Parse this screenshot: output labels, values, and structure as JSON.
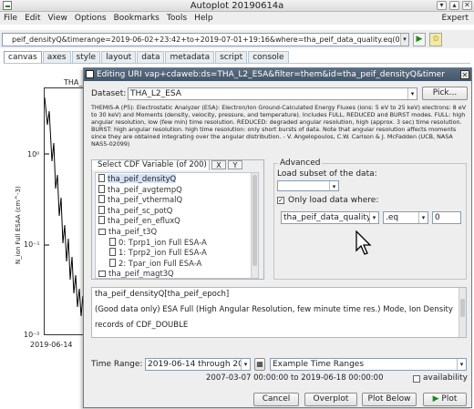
{
  "main_window": {
    "title": "Autoplot 20190614a",
    "controls": [
      "▾",
      "▴",
      "✕"
    ],
    "menu": [
      "File",
      "Edit",
      "View",
      "Options",
      "Bookmarks",
      "Tools",
      "Help"
    ],
    "expert_label": "Expert",
    "uri": "peif_densityQ&timerange=2019-06-02+23:42+to+2019-07-01+19:16&where=tha_peif_data_quality.eq(0)",
    "uri_dropdown": "▾",
    "go_button": "▶",
    "bookmark_button": "✩",
    "tabs": [
      "canvas",
      "axes",
      "style",
      "layout",
      "data",
      "metadata",
      "script",
      "console"
    ],
    "active_tab": "canvas"
  },
  "plot": {
    "title": "THA_L",
    "ylabel": "N_ion Full ESAA (cm^-3)",
    "yticks": [
      "10⁰",
      "10⁻¹",
      "10⁻²"
    ],
    "xtick": "2019-06-14"
  },
  "dialog": {
    "title": "Editing URI vap+cdaweb:ds=THA_L2_ESA&filter=them&id=tha_peif_densityQ&timer",
    "close": "✕",
    "dataset_label": "Dataset:",
    "dataset_value": "THA_L2_ESA",
    "pick_button": "Pick...",
    "description": "THEMIS-A (P5): Electrostatic Analyzer (ESA): Electron/Ion Ground-Calculated Energy Fluxes (ions: 5 eV to 25 keV) electrons: 8 eV to 30 keV) and Moments (density, velocity, pressure, and temperature). Includes FULL, REDUCED and BURST modes. FULL: high angular resolution, low (few min) time resolution. REDUCED: degraded angular resolution, high (approx. 3 sec) time resolution. BURST: high angular resolution. high time resolution: only short bursts of data. Note that angular resolution affects moments since they are obtained integrating over the angular distribution. - V. Angelopoulos, C.W. Carlson & J. McFadden (UCB, NASA NAS5-02099)",
    "cdf_tab_label": "Select CDF Variable (of 200)",
    "x_button": "X",
    "y_button": "Y",
    "variables": [
      {
        "label": "tha_peif_densityQ",
        "kind": "doc",
        "indent": 0,
        "selected": true
      },
      {
        "label": "tha_peif_avgtempQ",
        "kind": "doc",
        "indent": 0,
        "selected": false
      },
      {
        "label": "tha_peif_vthermalQ",
        "kind": "doc",
        "indent": 0,
        "selected": false
      },
      {
        "label": "tha_peif_sc_potQ",
        "kind": "doc",
        "indent": 0,
        "selected": false
      },
      {
        "label": "tha_peif_en_efluxQ",
        "kind": "doc",
        "indent": 0,
        "selected": false
      },
      {
        "label": "tha_peif_t3Q",
        "kind": "folder",
        "indent": 0,
        "selected": false
      },
      {
        "label": "0: Tprp1_ion Full ESA-A",
        "kind": "doc",
        "indent": 1,
        "selected": false
      },
      {
        "label": "1: Tprp2_ion Full ESA-A",
        "kind": "doc",
        "indent": 1,
        "selected": false
      },
      {
        "label": "2: Tpar_ion Full ESA-A",
        "kind": "doc",
        "indent": 1,
        "selected": false
      },
      {
        "label": "tha_peif_magt3Q",
        "kind": "folder",
        "indent": 0,
        "selected": false
      }
    ],
    "advanced_label": "Advanced",
    "load_subset_label": "Load subset of the data:",
    "subset_value": "",
    "only_load_checked": true,
    "only_load_label": "Only load data where:",
    "where_variable": "tha_peif_data_quality",
    "where_op": ".eq",
    "where_value": "0",
    "info_lines": [
      "tha_peif_densityQ[tha_peif_epoch]",
      "(Good data only) ESA Full (High Angular Resolution, few minute time res.) Mode, Ion Density",
      "records of CDF_DOUBLE"
    ],
    "time_range_label": "Time Range:",
    "time_range_value": "2019-06-14 through 2019",
    "example_ranges": "Example Time Ranges",
    "available_range": "2007-03-07 00:00:00 to 2019-06-18 00:00:00",
    "availability_label": "availability",
    "availability_checked": false,
    "buttons": {
      "cancel": "Cancel",
      "overplot": "Overplot",
      "plot_below": "Plot Below",
      "plot": "Plot"
    }
  }
}
